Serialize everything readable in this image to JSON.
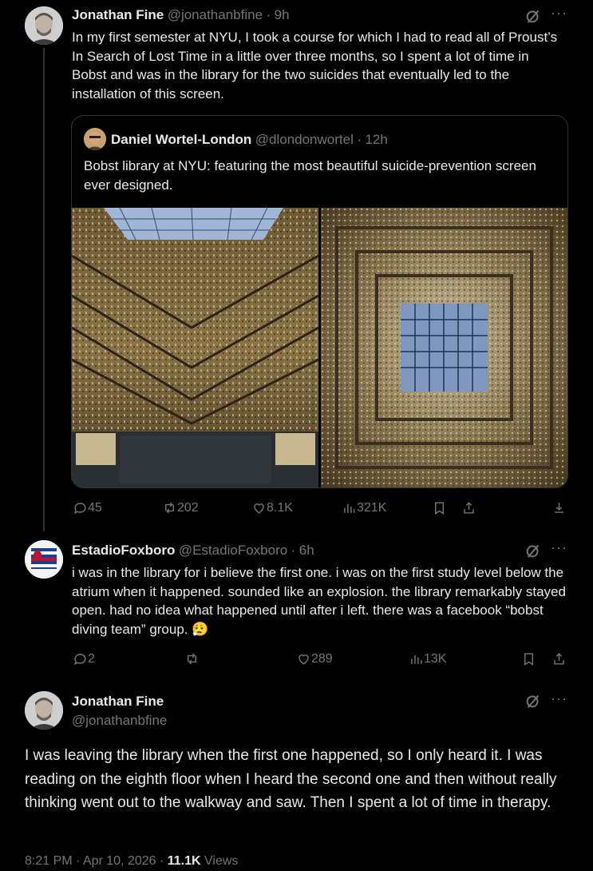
{
  "tweet1": {
    "name": "Jonathan Fine",
    "handle": "@jonathanbfine",
    "time": "9h",
    "text": "In my first semester at NYU, I took a course for which I had to read all of Proust’s In Search of Lost Time in a little over three months, so I spent a lot of time in Bobst and was in the library for the two suicides that eventually led to the installation of this screen.",
    "quote": {
      "name": "Daniel Wortel-London",
      "handle": "@dlondonwortel",
      "time": "12h",
      "text": "Bobst library at NYU: featuring the most beautiful suicide-prevention screen ever designed."
    },
    "stats": {
      "replies": "45",
      "reposts": "202",
      "likes": "8.1K",
      "views": "321K"
    }
  },
  "tweet2": {
    "name": "EstadioFoxboro",
    "handle": "@EstadioFoxboro",
    "time": "6h",
    "text": "i was in the library for i believe the first one. i was on the first study level below the atrium when it happened. sounded like an explosion. the library remarkably stayed open. had no idea what happened until after i left. there was a facebook “bobst diving team” group. 😮‍💨",
    "stats": {
      "replies": "2",
      "reposts": "",
      "likes": "289",
      "views": "13K"
    }
  },
  "main": {
    "name": "Jonathan Fine",
    "handle": "@jonathanbfine",
    "text": "I was leaving the library when the first one happened, so I only heard it. I was reading on the eighth floor when I heard the second one and then without really thinking went out to the walkway and saw. Then I spent a lot of time in therapy.",
    "timestamp": "8:21 PM · Apr 10, 2026 · ",
    "views_count": "11.1K",
    "views_label": "Views"
  },
  "sep": "·",
  "dots": "···",
  "icons": [
    "grok-icon",
    "more-icon",
    "reply-icon",
    "repost-icon",
    "like-icon",
    "views-icon",
    "bookmark-icon",
    "share-icon",
    "download-icon"
  ]
}
